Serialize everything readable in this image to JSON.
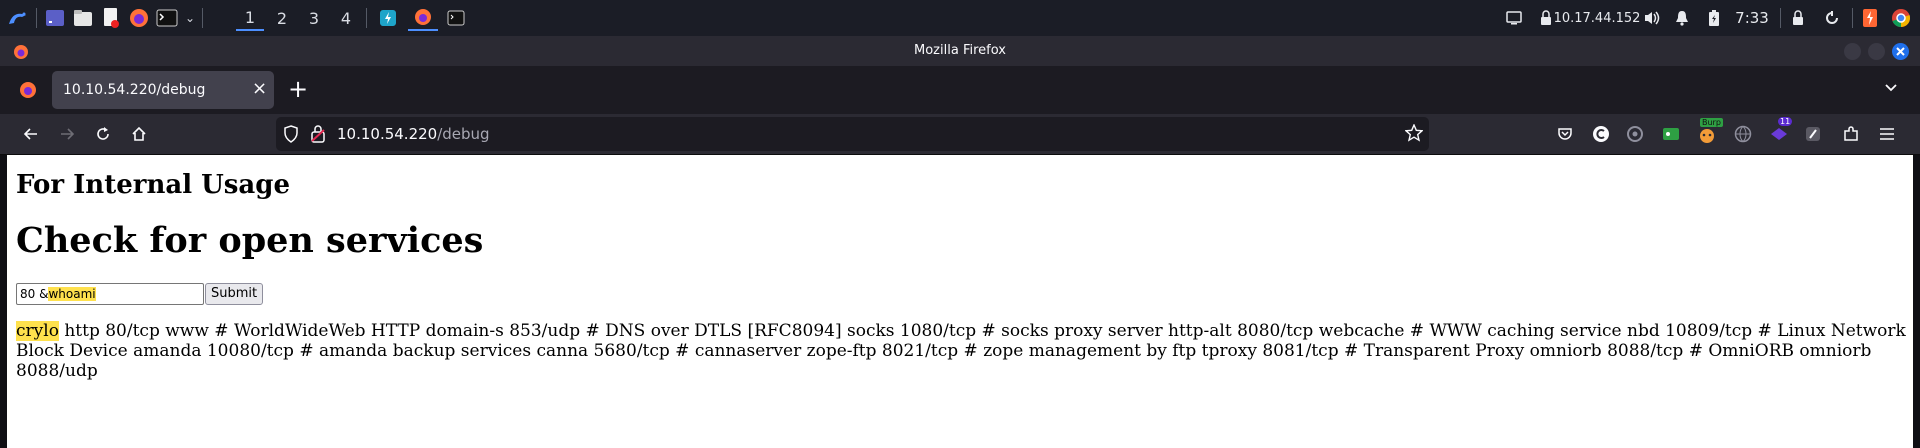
{
  "panel": {
    "workspaces": [
      "1",
      "2",
      "3",
      "4"
    ],
    "ip": "10.17.44.152",
    "time": "7:33"
  },
  "window": {
    "title": "Mozilla Firefox"
  },
  "tab": {
    "title": "10.10.54.220/debug",
    "close": "×",
    "new": "+"
  },
  "urlbar": {
    "host": "10.10.54.220",
    "path": "/debug"
  },
  "extensions": {
    "burp_badge": "Burp",
    "count_badge": "11"
  },
  "page": {
    "heading_small": "For Internal Usage",
    "heading_large": "Check for open services",
    "input_prefix": "80 &",
    "input_highlight": "whoami",
    "submit_label": "Submit",
    "output_highlight": "crylo",
    "output_text": " http 80/tcp www # WorldWideWeb HTTP domain-s 853/udp # DNS over DTLS [RFC8094] socks 1080/tcp # socks proxy server http-alt 8080/tcp webcache # WWW caching service nbd 10809/tcp # Linux Network Block Device amanda 10080/tcp # amanda backup services canna 5680/tcp # cannaserver zope-ftp 8021/tcp # zope management by ftp tproxy 8081/tcp # Transparent Proxy omniorb 8088/tcp # OmniORB omniorb 8088/udp"
  },
  "colors": {
    "accent": "#4d8fff",
    "highlight": "#ffe14d",
    "firefox_chrome": "#2b2a33"
  }
}
